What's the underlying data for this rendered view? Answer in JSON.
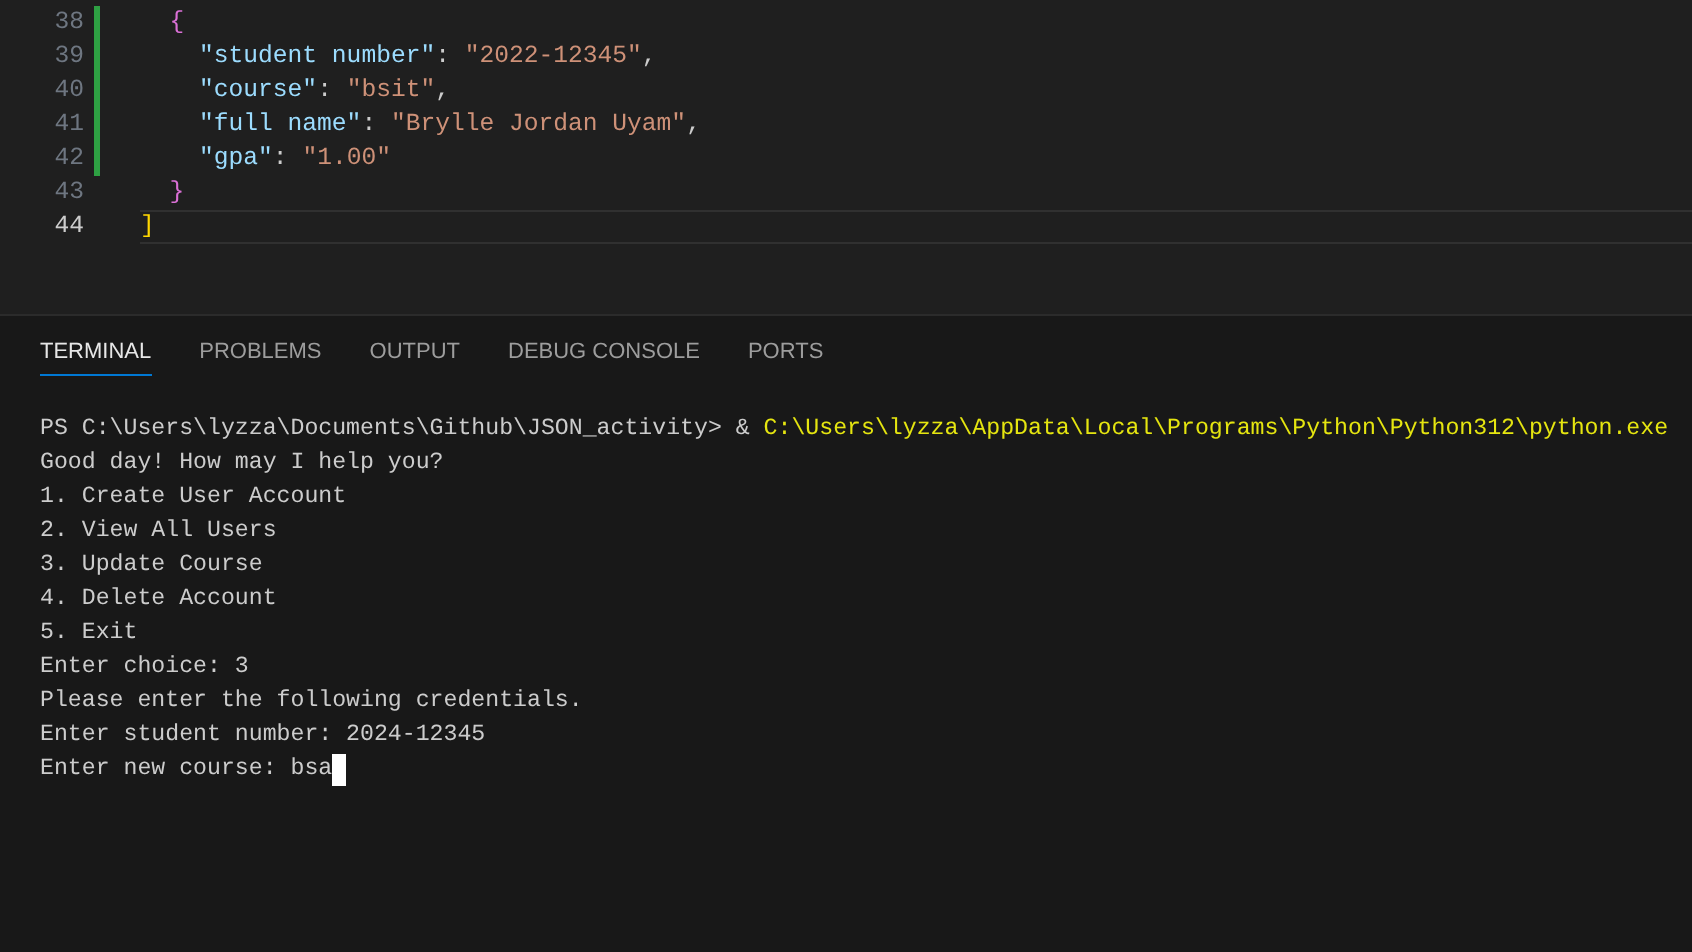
{
  "editor": {
    "lines": [
      {
        "number": "38",
        "modified": true,
        "current": false,
        "tokens": [
          {
            "kind": "brace",
            "text": "  {"
          }
        ]
      },
      {
        "number": "39",
        "modified": true,
        "current": false,
        "tokens": [
          {
            "kind": "key",
            "text": "    \"student number\""
          },
          {
            "kind": "punct",
            "text": ": "
          },
          {
            "kind": "string",
            "text": "\"2022-12345\""
          },
          {
            "kind": "punct",
            "text": ","
          }
        ]
      },
      {
        "number": "40",
        "modified": true,
        "current": false,
        "tokens": [
          {
            "kind": "key",
            "text": "    \"course\""
          },
          {
            "kind": "punct",
            "text": ": "
          },
          {
            "kind": "string",
            "text": "\"bsit\""
          },
          {
            "kind": "punct",
            "text": ","
          }
        ]
      },
      {
        "number": "41",
        "modified": true,
        "current": false,
        "tokens": [
          {
            "kind": "key",
            "text": "    \"full name\""
          },
          {
            "kind": "punct",
            "text": ": "
          },
          {
            "kind": "string",
            "text": "\"Brylle Jordan Uyam\""
          },
          {
            "kind": "punct",
            "text": ","
          }
        ]
      },
      {
        "number": "42",
        "modified": true,
        "current": false,
        "tokens": [
          {
            "kind": "key",
            "text": "    \"gpa\""
          },
          {
            "kind": "punct",
            "text": ": "
          },
          {
            "kind": "string",
            "text": "\"1.00\""
          }
        ]
      },
      {
        "number": "43",
        "modified": false,
        "current": false,
        "tokens": [
          {
            "kind": "brace",
            "text": "  }"
          }
        ]
      },
      {
        "number": "44",
        "modified": false,
        "current": true,
        "tokens": [
          {
            "kind": "bracket",
            "text": "]"
          }
        ]
      }
    ]
  },
  "panel": {
    "tabs": [
      {
        "label": "TERMINAL",
        "selected": true
      },
      {
        "label": "PROBLEMS",
        "selected": false
      },
      {
        "label": "OUTPUT",
        "selected": false
      },
      {
        "label": "DEBUG CONSOLE",
        "selected": false
      },
      {
        "label": "PORTS",
        "selected": false
      }
    ],
    "terminal": {
      "lines": [
        {
          "segments": [
            {
              "kind": "prompt",
              "text": "PS C:\\Users\\lyzza\\Documents\\Github\\JSON_activity> & "
            },
            {
              "kind": "command",
              "text": "C:\\Users\\lyzza\\AppData\\Local\\Programs\\Python\\Python312\\python.exe"
            }
          ],
          "cursor": false
        },
        {
          "segments": [
            {
              "kind": "output",
              "text": "Good day! How may I help you?"
            }
          ],
          "cursor": false
        },
        {
          "segments": [
            {
              "kind": "output",
              "text": "1. Create User Account"
            }
          ],
          "cursor": false
        },
        {
          "segments": [
            {
              "kind": "output",
              "text": "2. View All Users"
            }
          ],
          "cursor": false
        },
        {
          "segments": [
            {
              "kind": "output",
              "text": "3. Update Course"
            }
          ],
          "cursor": false
        },
        {
          "segments": [
            {
              "kind": "output",
              "text": "4. Delete Account"
            }
          ],
          "cursor": false
        },
        {
          "segments": [
            {
              "kind": "output",
              "text": "5. Exit"
            }
          ],
          "cursor": false
        },
        {
          "segments": [
            {
              "kind": "output",
              "text": "Enter choice: 3"
            }
          ],
          "cursor": false
        },
        {
          "segments": [
            {
              "kind": "output",
              "text": "Please enter the following credentials."
            }
          ],
          "cursor": false
        },
        {
          "segments": [
            {
              "kind": "output",
              "text": "Enter student number: 2024-12345"
            }
          ],
          "cursor": false
        },
        {
          "segments": [
            {
              "kind": "output",
              "text": "Enter new course: bsa"
            }
          ],
          "cursor": true
        }
      ]
    }
  }
}
